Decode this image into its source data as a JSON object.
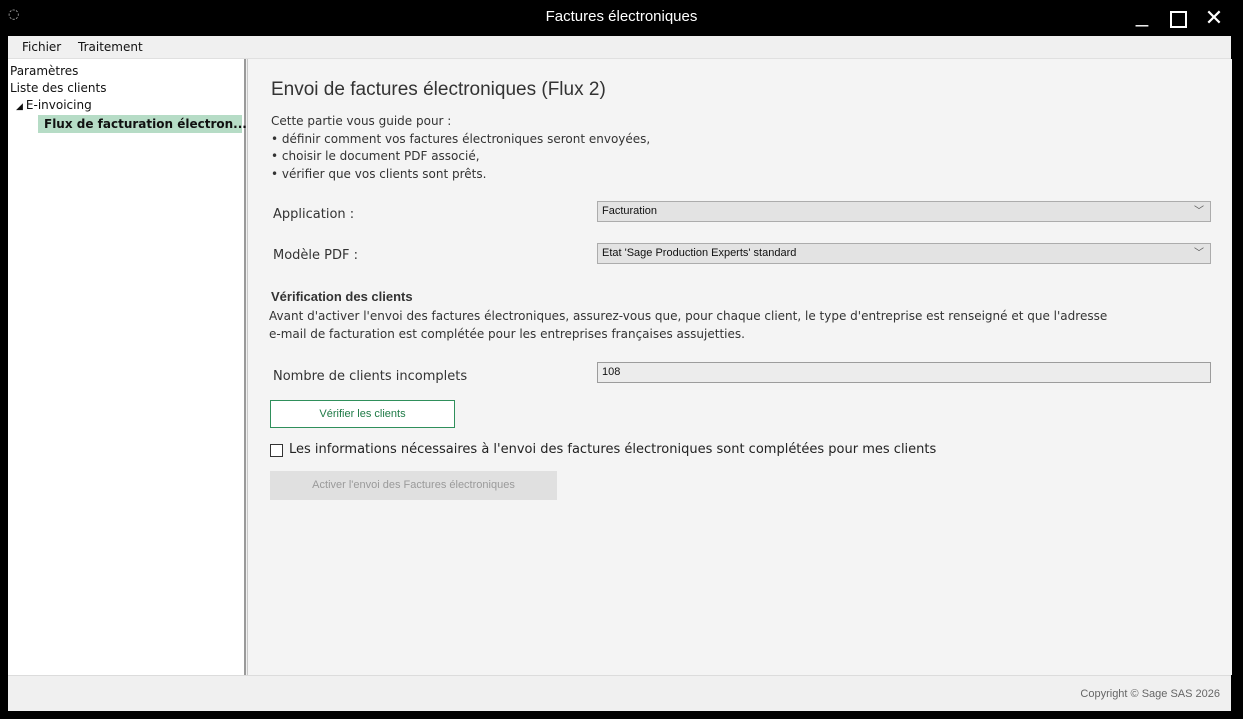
{
  "window": {
    "title": "Factures électroniques",
    "app_icon": "loading-dots-icon",
    "controls": {
      "minimize": "_",
      "maximize": "maximize-icon",
      "close": "✕"
    }
  },
  "menu": [
    {
      "label": "Fichier"
    },
    {
      "label": "Traitement"
    }
  ],
  "sidebar": {
    "items": [
      {
        "label": "Paramètres"
      },
      {
        "label": "Liste des clients"
      },
      {
        "label": "E-invoicing",
        "expanded": true
      },
      {
        "label": "Flux de facturation électron...",
        "selected": true
      }
    ]
  },
  "main": {
    "title": "Envoi de factures électroniques (Flux 2)",
    "intro": "Cette partie vous guide pour :",
    "bullets": [
      "• définir comment vos factures électroniques seront envoyées,",
      "• choisir le document PDF associé,",
      "• vérifier que vos clients sont prêts."
    ],
    "application_label": "Application :",
    "application_value": "Facturation",
    "pdf_label": "Modèle PDF :",
    "pdf_value": "Etat 'Sage Production Experts' standard",
    "verification_title": "Vérification des clients",
    "verification_text_1": "Avant d'activer l'envoi des factures électroniques, assurez-vous que, pour chaque client, le type d'entreprise est renseigné et que l'adresse",
    "verification_text_2": "e-mail de facturation est complétée pour les entreprises françaises assujetties.",
    "count_label": "Nombre de clients incomplets",
    "count_value": "108",
    "verify_button": "Vérifier les clients",
    "checkbox_label": "Les informations nécessaires à l'envoi des factures électroniques sont complétées pour mes clients",
    "checkbox_checked": false,
    "activate_button": "Activer l'envoi des Factures électroniques"
  },
  "status": {
    "copyright": "Copyright © Sage SAS 2026"
  },
  "colors": {
    "accent": "#2f8f5b",
    "selected_bg": "#b6dcc6",
    "titlebar": "#000000"
  }
}
